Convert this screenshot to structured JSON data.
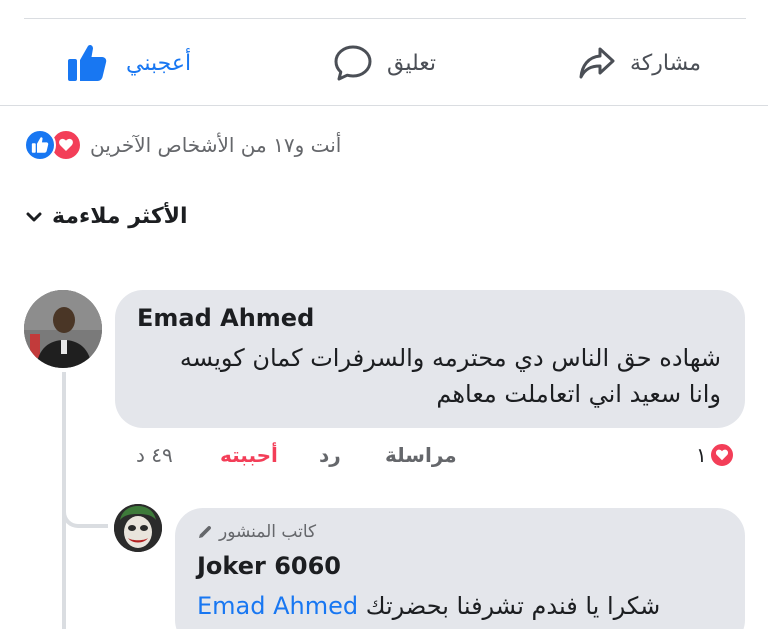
{
  "actions": {
    "share_label": "مشاركة",
    "comment_label": "تعليق",
    "like_label": "أعجبني",
    "like_color": "#1877f2"
  },
  "reactions": {
    "summary": "أنت و١٧ من الأشخاص الآخرين",
    "types": [
      "like-icon",
      "love-icon"
    ]
  },
  "sort": {
    "label": "الأكثر ملاءمة"
  },
  "comments": [
    {
      "author": "Emad Ahmed",
      "text": "شهاده حق الناس دي محترمه والسرفرات كمان كويسه وانا سعيد اني اتعاملت معاهم",
      "actions": {
        "message": "مراسلة",
        "reply": "رد",
        "liked": "أحببته",
        "time": "٤٩ د"
      },
      "reaction_count": "١"
    }
  ],
  "reply": {
    "badge": "كاتب المنشور",
    "author": "Joker 6060",
    "text": "شكرا يا فندم تشرفنا بحضرتك",
    "mention": "Emad Ahmed"
  }
}
